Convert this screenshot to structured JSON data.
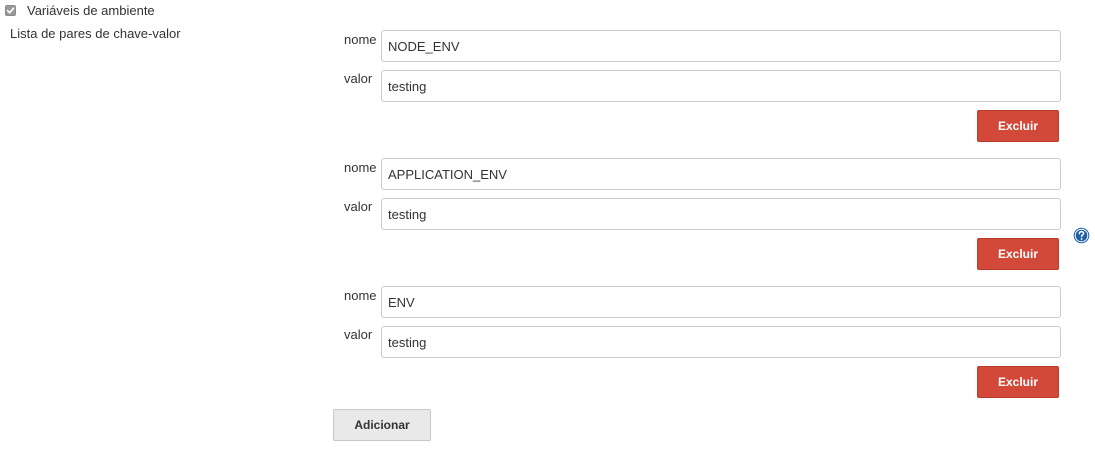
{
  "env_vars": {
    "checkbox_label": "Variáveis de ambiente",
    "checked": true,
    "section_label": "Lista de pares de chave-valor",
    "name_label": "nome",
    "value_label": "valor",
    "delete_label": "Excluir",
    "add_label": "Adicionar",
    "help_icon": "question-circle-icon",
    "pairs": [
      {
        "name": "NODE_ENV",
        "value": "testing"
      },
      {
        "name": "APPLICATION_ENV",
        "value": "testing"
      },
      {
        "name": "ENV",
        "value": "testing"
      }
    ]
  },
  "colors": {
    "delete_button": "#d24939",
    "add_button": "#e9e9e9",
    "help_icon": "#1f5fa6"
  }
}
